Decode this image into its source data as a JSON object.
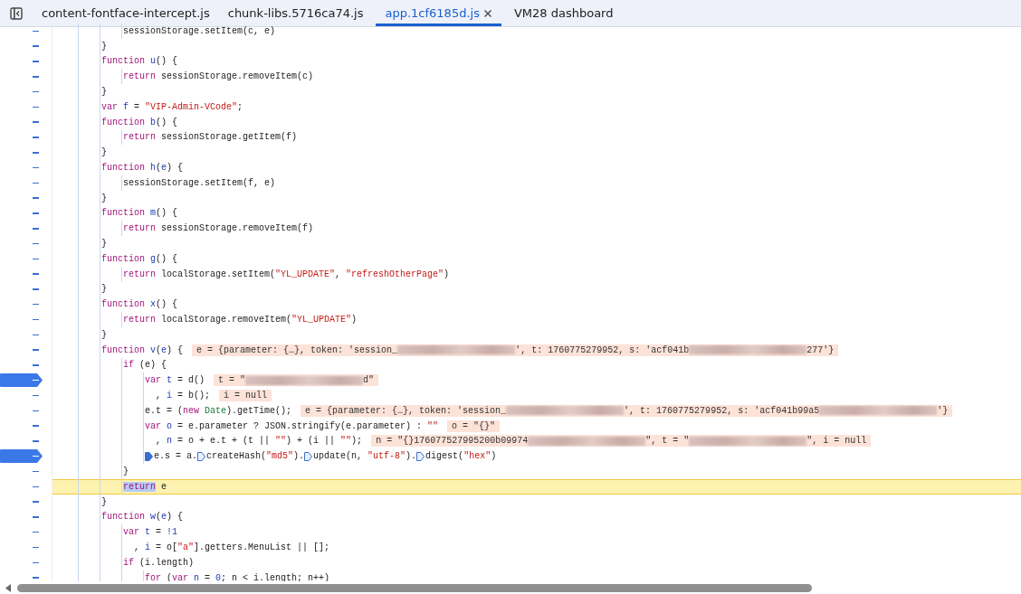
{
  "tabs": [
    {
      "label": "content-fontface-intercept.js",
      "selected": false,
      "closable": false
    },
    {
      "label": "chunk-libs.5716ca74.js",
      "selected": false,
      "closable": false
    },
    {
      "label": "app.1cf6185d.js",
      "selected": true,
      "closable": true
    },
    {
      "label": "VM28 dashboard",
      "selected": false,
      "closable": false
    }
  ],
  "lines": [
    {
      "breakpoint": false,
      "current": false,
      "tokens": [
        {
          "kind": "plain",
          "text": "            sessionStorage.setItem(c, e)"
        }
      ]
    },
    {
      "breakpoint": false,
      "current": false,
      "tokens": [
        {
          "kind": "plain",
          "text": "        }"
        }
      ]
    },
    {
      "breakpoint": false,
      "current": false,
      "tokens": [
        {
          "kind": "keyword",
          "text": "        function"
        },
        {
          "kind": "name",
          "text": " u"
        },
        {
          "kind": "plain",
          "text": "() {"
        }
      ]
    },
    {
      "breakpoint": false,
      "current": false,
      "tokens": [
        {
          "kind": "keyword",
          "text": "            return"
        },
        {
          "kind": "plain",
          "text": " sessionStorage.removeItem(c)"
        }
      ]
    },
    {
      "breakpoint": false,
      "current": false,
      "tokens": [
        {
          "kind": "plain",
          "text": "        }"
        }
      ]
    },
    {
      "breakpoint": false,
      "current": false,
      "tokens": [
        {
          "kind": "keyword",
          "text": "        var"
        },
        {
          "kind": "name",
          "text": " f"
        },
        {
          "kind": "plain",
          "text": " = "
        },
        {
          "kind": "string",
          "text": "\"VIP-Admin-VCode\""
        },
        {
          "kind": "plain",
          "text": ";"
        }
      ]
    },
    {
      "breakpoint": false,
      "current": false,
      "tokens": [
        {
          "kind": "keyword",
          "text": "        function"
        },
        {
          "kind": "name",
          "text": " b"
        },
        {
          "kind": "plain",
          "text": "() {"
        }
      ]
    },
    {
      "breakpoint": false,
      "current": false,
      "tokens": [
        {
          "kind": "keyword",
          "text": "            return"
        },
        {
          "kind": "plain",
          "text": " sessionStorage.getItem(f)"
        }
      ]
    },
    {
      "breakpoint": false,
      "current": false,
      "tokens": [
        {
          "kind": "plain",
          "text": "        }"
        }
      ]
    },
    {
      "breakpoint": false,
      "current": false,
      "tokens": [
        {
          "kind": "keyword",
          "text": "        function"
        },
        {
          "kind": "name",
          "text": " h"
        },
        {
          "kind": "plain",
          "text": "("
        },
        {
          "kind": "name",
          "text": "e"
        },
        {
          "kind": "plain",
          "text": ") {"
        }
      ]
    },
    {
      "breakpoint": false,
      "current": false,
      "tokens": [
        {
          "kind": "plain",
          "text": "            sessionStorage.setItem(f, e)"
        }
      ]
    },
    {
      "breakpoint": false,
      "current": false,
      "tokens": [
        {
          "kind": "plain",
          "text": "        }"
        }
      ]
    },
    {
      "breakpoint": false,
      "current": false,
      "tokens": [
        {
          "kind": "keyword",
          "text": "        function"
        },
        {
          "kind": "name",
          "text": " m"
        },
        {
          "kind": "plain",
          "text": "() {"
        }
      ]
    },
    {
      "breakpoint": false,
      "current": false,
      "tokens": [
        {
          "kind": "keyword",
          "text": "            return"
        },
        {
          "kind": "plain",
          "text": " sessionStorage.removeItem(f)"
        }
      ]
    },
    {
      "breakpoint": false,
      "current": false,
      "tokens": [
        {
          "kind": "plain",
          "text": "        }"
        }
      ]
    },
    {
      "breakpoint": false,
      "current": false,
      "tokens": [
        {
          "kind": "keyword",
          "text": "        function"
        },
        {
          "kind": "name",
          "text": " g"
        },
        {
          "kind": "plain",
          "text": "() {"
        }
      ]
    },
    {
      "breakpoint": false,
      "current": false,
      "tokens": [
        {
          "kind": "keyword",
          "text": "            return"
        },
        {
          "kind": "plain",
          "text": " localStorage.setItem("
        },
        {
          "kind": "string",
          "text": "\"YL_UPDATE\""
        },
        {
          "kind": "plain",
          "text": ", "
        },
        {
          "kind": "string",
          "text": "\"refreshOtherPage\""
        },
        {
          "kind": "plain",
          "text": ")"
        }
      ]
    },
    {
      "breakpoint": false,
      "current": false,
      "tokens": [
        {
          "kind": "plain",
          "text": "        }"
        }
      ]
    },
    {
      "breakpoint": false,
      "current": false,
      "tokens": [
        {
          "kind": "keyword",
          "text": "        function"
        },
        {
          "kind": "name",
          "text": " x"
        },
        {
          "kind": "plain",
          "text": "() {"
        }
      ]
    },
    {
      "breakpoint": false,
      "current": false,
      "tokens": [
        {
          "kind": "keyword",
          "text": "            return"
        },
        {
          "kind": "plain",
          "text": " localStorage.removeItem("
        },
        {
          "kind": "string",
          "text": "\"YL_UPDATE\""
        },
        {
          "kind": "plain",
          "text": ")"
        }
      ]
    },
    {
      "breakpoint": false,
      "current": false,
      "tokens": [
        {
          "kind": "plain",
          "text": "        }"
        }
      ]
    },
    {
      "breakpoint": false,
      "current": false,
      "tokens": [
        {
          "kind": "keyword",
          "text": "        function"
        },
        {
          "kind": "name",
          "text": " v"
        },
        {
          "kind": "plain",
          "text": "("
        },
        {
          "kind": "name",
          "text": "e"
        },
        {
          "kind": "plain",
          "text": ") {"
        }
      ],
      "inline": [
        {
          "kind": "text",
          "text": "e = {parameter: {…}, token: 'session_"
        },
        {
          "kind": "redacted"
        },
        {
          "kind": "text",
          "text": "', t: 1760775279952, s: 'acf041b"
        },
        {
          "kind": "redacted"
        },
        {
          "kind": "text",
          "text": "277'}"
        }
      ]
    },
    {
      "breakpoint": false,
      "current": false,
      "tokens": [
        {
          "kind": "keyword",
          "text": "            if"
        },
        {
          "kind": "plain",
          "text": " (e) {"
        }
      ]
    },
    {
      "breakpoint": true,
      "current": false,
      "tokens": [
        {
          "kind": "keyword",
          "text": "                var"
        },
        {
          "kind": "name",
          "text": " t"
        },
        {
          "kind": "plain",
          "text": " = d()"
        }
      ],
      "inline": [
        {
          "kind": "text",
          "text": "t = \""
        },
        {
          "kind": "redacted"
        },
        {
          "kind": "text",
          "text": "d\""
        }
      ]
    },
    {
      "breakpoint": false,
      "current": false,
      "tokens": [
        {
          "kind": "plain",
          "text": "                  ,"
        },
        {
          "kind": "name",
          "text": " i"
        },
        {
          "kind": "plain",
          "text": " = b();"
        }
      ],
      "inline": [
        {
          "kind": "text",
          "text": "i = null"
        }
      ]
    },
    {
      "breakpoint": false,
      "current": false,
      "tokens": [
        {
          "kind": "plain",
          "text": "                e.t = ("
        },
        {
          "kind": "keyword",
          "text": "new"
        },
        {
          "kind": "class",
          "text": " Date"
        },
        {
          "kind": "plain",
          "text": ").getTime();"
        }
      ],
      "inline": [
        {
          "kind": "text",
          "text": "e = {parameter: {…}, token: 'session_"
        },
        {
          "kind": "redacted"
        },
        {
          "kind": "text",
          "text": "', t: 1760775279952, s: 'acf041b99a5"
        },
        {
          "kind": "redacted"
        },
        {
          "kind": "text",
          "text": "'}"
        }
      ]
    },
    {
      "breakpoint": false,
      "current": false,
      "tokens": [
        {
          "kind": "keyword",
          "text": "                var"
        },
        {
          "kind": "name",
          "text": " o"
        },
        {
          "kind": "plain",
          "text": " = e.parameter ? JSON.stringify(e.parameter) :"
        },
        {
          "kind": "string",
          "text": " \"\""
        }
      ],
      "inline": [
        {
          "kind": "text",
          "text": "o = \"{}\""
        }
      ]
    },
    {
      "breakpoint": false,
      "current": false,
      "tokens": [
        {
          "kind": "plain",
          "text": "                  ,"
        },
        {
          "kind": "name",
          "text": " n"
        },
        {
          "kind": "plain",
          "text": " = o + e.t + (t ||"
        },
        {
          "kind": "string",
          "text": " \"\""
        },
        {
          "kind": "plain",
          "text": ") + (i ||"
        },
        {
          "kind": "string",
          "text": " \"\""
        },
        {
          "kind": "plain",
          "text": ");"
        }
      ],
      "inline": [
        {
          "kind": "text",
          "text": "n = \"{}176077527995200b09974"
        },
        {
          "kind": "redacted"
        },
        {
          "kind": "text",
          "text": "\", t = \""
        },
        {
          "kind": "redacted"
        },
        {
          "kind": "text",
          "text": "\", i = null"
        }
      ]
    },
    {
      "breakpoint": true,
      "current": false,
      "tokens": [
        {
          "kind": "marker",
          "filled": true
        },
        {
          "kind": "plain",
          "text": "                e.s = a."
        },
        {
          "kind": "marker",
          "filled": false
        },
        {
          "kind": "plain",
          "text": "createHash("
        },
        {
          "kind": "string",
          "text": "\"md5\""
        },
        {
          "kind": "plain",
          "text": ")."
        },
        {
          "kind": "marker",
          "filled": false
        },
        {
          "kind": "plain",
          "text": "update(n,"
        },
        {
          "kind": "string",
          "text": " \"utf-8\""
        },
        {
          "kind": "plain",
          "text": ")."
        },
        {
          "kind": "marker",
          "filled": false
        },
        {
          "kind": "plain",
          "text": "digest("
        },
        {
          "kind": "string",
          "text": "\"hex\""
        },
        {
          "kind": "plain",
          "text": ")"
        }
      ]
    },
    {
      "breakpoint": false,
      "current": false,
      "tokens": [
        {
          "kind": "plain",
          "text": "            }"
        }
      ]
    },
    {
      "breakpoint": false,
      "current": true,
      "tokens": [
        {
          "kind": "keyword-highlight",
          "text": "            return"
        },
        {
          "kind": "plain",
          "text": " e"
        }
      ]
    },
    {
      "breakpoint": false,
      "current": false,
      "tokens": [
        {
          "kind": "plain",
          "text": "        }"
        }
      ]
    },
    {
      "breakpoint": false,
      "current": false,
      "tokens": [
        {
          "kind": "keyword",
          "text": "        function"
        },
        {
          "kind": "name",
          "text": " w"
        },
        {
          "kind": "plain",
          "text": "("
        },
        {
          "kind": "name",
          "text": "e"
        },
        {
          "kind": "plain",
          "text": ") {"
        }
      ]
    },
    {
      "breakpoint": false,
      "current": false,
      "tokens": [
        {
          "kind": "keyword",
          "text": "            var"
        },
        {
          "kind": "name",
          "text": " t"
        },
        {
          "kind": "plain",
          "text": " ="
        },
        {
          "kind": "number",
          "text": " !1"
        }
      ]
    },
    {
      "breakpoint": false,
      "current": false,
      "tokens": [
        {
          "kind": "plain",
          "text": "              ,"
        },
        {
          "kind": "name",
          "text": " i"
        },
        {
          "kind": "plain",
          "text": " = o["
        },
        {
          "kind": "string",
          "text": "\"a\""
        },
        {
          "kind": "plain",
          "text": "].getters.MenuList || [];"
        }
      ]
    },
    {
      "breakpoint": false,
      "current": false,
      "tokens": [
        {
          "kind": "keyword",
          "text": "            if"
        },
        {
          "kind": "plain",
          "text": " (i.length)"
        }
      ]
    },
    {
      "breakpoint": false,
      "current": false,
      "tokens": [
        {
          "kind": "keyword",
          "text": "                for"
        },
        {
          "kind": "plain",
          "text": " ("
        },
        {
          "kind": "keyword",
          "text": "var"
        },
        {
          "kind": "name",
          "text": " n"
        },
        {
          "kind": "plain",
          "text": " ="
        },
        {
          "kind": "number",
          "text": " 0"
        },
        {
          "kind": "plain",
          "text": "; n < i.length; n++)"
        }
      ]
    }
  ]
}
